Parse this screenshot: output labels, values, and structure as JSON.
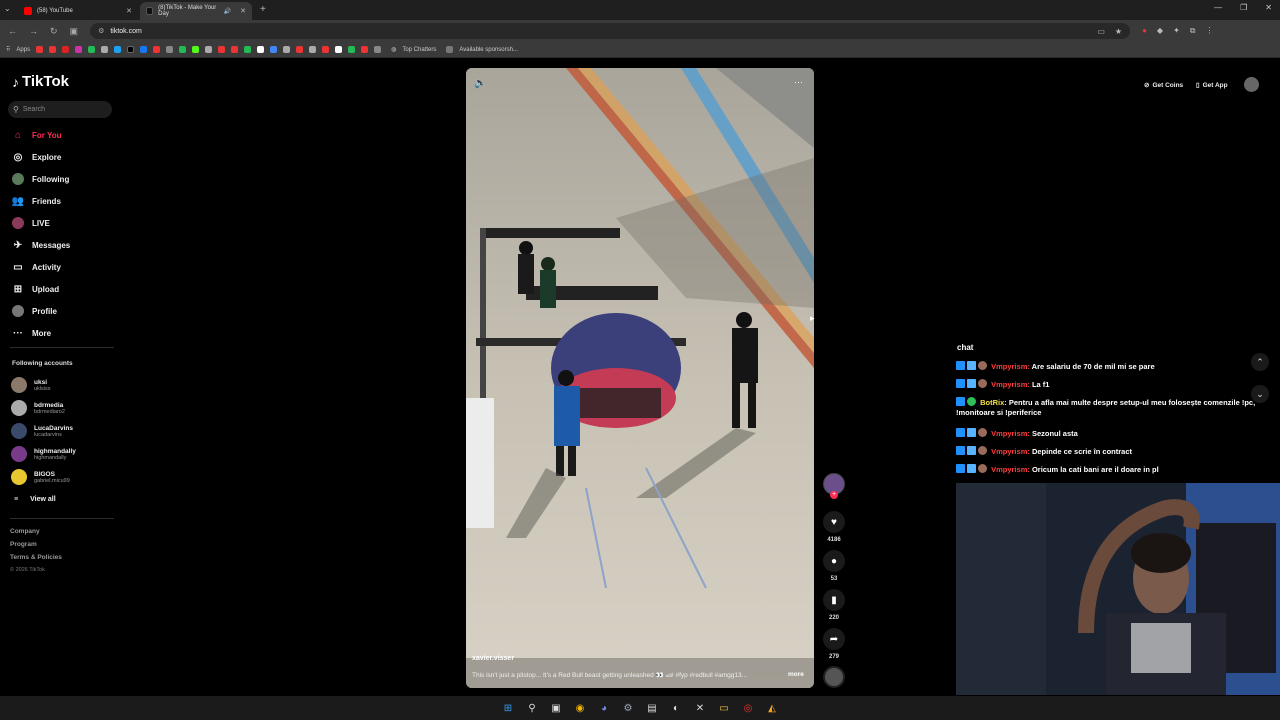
{
  "browser": {
    "tabs": [
      {
        "label": "(58) YouTube",
        "active": false
      },
      {
        "label": "(8)TikTok - Make Your Day",
        "active": true
      }
    ],
    "url": "tiktok.com",
    "bookmarks": [
      "Apps",
      "Top Chatters",
      "Available sponsorsh..."
    ]
  },
  "sidebar": {
    "logo": "TikTok",
    "search_placeholder": "Search",
    "nav": [
      {
        "label": "For You",
        "icon": "home-icon",
        "selected": true
      },
      {
        "label": "Explore",
        "icon": "compass-icon"
      },
      {
        "label": "Following",
        "icon": "following-avatar-icon"
      },
      {
        "label": "Friends",
        "icon": "friends-icon"
      },
      {
        "label": "LIVE",
        "icon": "live-icon"
      },
      {
        "label": "Messages",
        "icon": "messages-icon"
      },
      {
        "label": "Activity",
        "icon": "activity-icon"
      },
      {
        "label": "Upload",
        "icon": "upload-icon"
      },
      {
        "label": "Profile",
        "icon": "profile-icon"
      },
      {
        "label": "More",
        "icon": "more-icon"
      }
    ],
    "following_title": "Following accounts",
    "following": [
      {
        "name": "uksi",
        "handle": "uklsiss"
      },
      {
        "name": "bdrmedia",
        "handle": "bdrmediaro2"
      },
      {
        "name": "LucaDarvins",
        "handle": "lucadarvins"
      },
      {
        "name": "highmandally",
        "handle": "highmandally"
      },
      {
        "name": "BIGOS",
        "handle": "gabriel.micu99"
      }
    ],
    "view_all": "View all",
    "footer": [
      "Company",
      "Program",
      "Terms & Policies"
    ],
    "copyright": "© 2026 TikTok"
  },
  "header": {
    "get_coins": "Get Coins",
    "get_app": "Get App"
  },
  "video": {
    "author": "xavier.visser",
    "caption": "This isn't just a pitstop... It's a Red Bull beast getting unleashed 👀 🏎 #fyp #redbull #amgg13...",
    "more": "more",
    "likes": "4186",
    "comments": "53",
    "saves": "220",
    "shares": "279"
  },
  "chat": {
    "title": "chat",
    "messages": [
      {
        "user": "Vmpyrism:",
        "text": "Are salariu de 70 de mil mi se pare",
        "color": "#ff3b3b",
        "bot": false
      },
      {
        "user": "Vmpyrism:",
        "text": "La f1",
        "color": "#ff3b3b",
        "bot": false
      },
      {
        "user": "BotRix:",
        "text": "Pentru a afla mai multe despre setup-ul meu folosește comenzile !pc, !monitoare si !periferice",
        "color": "#f5e24a",
        "bot": true
      },
      {
        "user": "Vmpyrism:",
        "text": "Sezonul asta",
        "color": "#ff3b3b",
        "bot": false
      },
      {
        "user": "Vmpyrism:",
        "text": "Depinde ce scrie în contract",
        "color": "#ff3b3b",
        "bot": false
      },
      {
        "user": "Vmpyrism:",
        "text": "Oricum la cati bani are il doare in pl",
        "color": "#ff3b3b",
        "bot": false
      }
    ]
  },
  "colors": {
    "accent": "#fe2c55",
    "chat_user": "#ff3b3b",
    "bot_user": "#f5e24a"
  }
}
